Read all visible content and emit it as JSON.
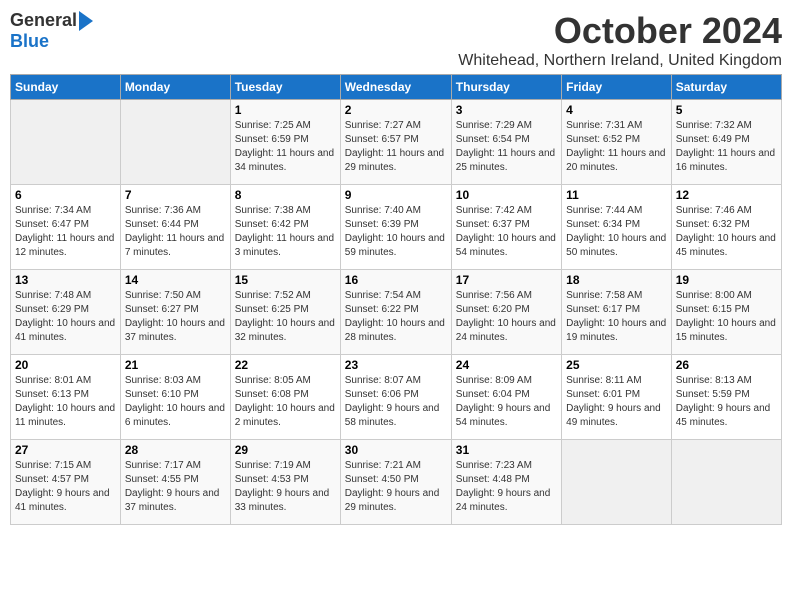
{
  "logo": {
    "general": "General",
    "blue": "Blue"
  },
  "title": "October 2024",
  "subtitle": "Whitehead, Northern Ireland, United Kingdom",
  "days_of_week": [
    "Sunday",
    "Monday",
    "Tuesday",
    "Wednesday",
    "Thursday",
    "Friday",
    "Saturday"
  ],
  "weeks": [
    [
      {
        "day": "",
        "info": ""
      },
      {
        "day": "",
        "info": ""
      },
      {
        "day": "1",
        "info": "Sunrise: 7:25 AM\nSunset: 6:59 PM\nDaylight: 11 hours and 34 minutes."
      },
      {
        "day": "2",
        "info": "Sunrise: 7:27 AM\nSunset: 6:57 PM\nDaylight: 11 hours and 29 minutes."
      },
      {
        "day": "3",
        "info": "Sunrise: 7:29 AM\nSunset: 6:54 PM\nDaylight: 11 hours and 25 minutes."
      },
      {
        "day": "4",
        "info": "Sunrise: 7:31 AM\nSunset: 6:52 PM\nDaylight: 11 hours and 20 minutes."
      },
      {
        "day": "5",
        "info": "Sunrise: 7:32 AM\nSunset: 6:49 PM\nDaylight: 11 hours and 16 minutes."
      }
    ],
    [
      {
        "day": "6",
        "info": "Sunrise: 7:34 AM\nSunset: 6:47 PM\nDaylight: 11 hours and 12 minutes."
      },
      {
        "day": "7",
        "info": "Sunrise: 7:36 AM\nSunset: 6:44 PM\nDaylight: 11 hours and 7 minutes."
      },
      {
        "day": "8",
        "info": "Sunrise: 7:38 AM\nSunset: 6:42 PM\nDaylight: 11 hours and 3 minutes."
      },
      {
        "day": "9",
        "info": "Sunrise: 7:40 AM\nSunset: 6:39 PM\nDaylight: 10 hours and 59 minutes."
      },
      {
        "day": "10",
        "info": "Sunrise: 7:42 AM\nSunset: 6:37 PM\nDaylight: 10 hours and 54 minutes."
      },
      {
        "day": "11",
        "info": "Sunrise: 7:44 AM\nSunset: 6:34 PM\nDaylight: 10 hours and 50 minutes."
      },
      {
        "day": "12",
        "info": "Sunrise: 7:46 AM\nSunset: 6:32 PM\nDaylight: 10 hours and 45 minutes."
      }
    ],
    [
      {
        "day": "13",
        "info": "Sunrise: 7:48 AM\nSunset: 6:29 PM\nDaylight: 10 hours and 41 minutes."
      },
      {
        "day": "14",
        "info": "Sunrise: 7:50 AM\nSunset: 6:27 PM\nDaylight: 10 hours and 37 minutes."
      },
      {
        "day": "15",
        "info": "Sunrise: 7:52 AM\nSunset: 6:25 PM\nDaylight: 10 hours and 32 minutes."
      },
      {
        "day": "16",
        "info": "Sunrise: 7:54 AM\nSunset: 6:22 PM\nDaylight: 10 hours and 28 minutes."
      },
      {
        "day": "17",
        "info": "Sunrise: 7:56 AM\nSunset: 6:20 PM\nDaylight: 10 hours and 24 minutes."
      },
      {
        "day": "18",
        "info": "Sunrise: 7:58 AM\nSunset: 6:17 PM\nDaylight: 10 hours and 19 minutes."
      },
      {
        "day": "19",
        "info": "Sunrise: 8:00 AM\nSunset: 6:15 PM\nDaylight: 10 hours and 15 minutes."
      }
    ],
    [
      {
        "day": "20",
        "info": "Sunrise: 8:01 AM\nSunset: 6:13 PM\nDaylight: 10 hours and 11 minutes."
      },
      {
        "day": "21",
        "info": "Sunrise: 8:03 AM\nSunset: 6:10 PM\nDaylight: 10 hours and 6 minutes."
      },
      {
        "day": "22",
        "info": "Sunrise: 8:05 AM\nSunset: 6:08 PM\nDaylight: 10 hours and 2 minutes."
      },
      {
        "day": "23",
        "info": "Sunrise: 8:07 AM\nSunset: 6:06 PM\nDaylight: 9 hours and 58 minutes."
      },
      {
        "day": "24",
        "info": "Sunrise: 8:09 AM\nSunset: 6:04 PM\nDaylight: 9 hours and 54 minutes."
      },
      {
        "day": "25",
        "info": "Sunrise: 8:11 AM\nSunset: 6:01 PM\nDaylight: 9 hours and 49 minutes."
      },
      {
        "day": "26",
        "info": "Sunrise: 8:13 AM\nSunset: 5:59 PM\nDaylight: 9 hours and 45 minutes."
      }
    ],
    [
      {
        "day": "27",
        "info": "Sunrise: 7:15 AM\nSunset: 4:57 PM\nDaylight: 9 hours and 41 minutes."
      },
      {
        "day": "28",
        "info": "Sunrise: 7:17 AM\nSunset: 4:55 PM\nDaylight: 9 hours and 37 minutes."
      },
      {
        "day": "29",
        "info": "Sunrise: 7:19 AM\nSunset: 4:53 PM\nDaylight: 9 hours and 33 minutes."
      },
      {
        "day": "30",
        "info": "Sunrise: 7:21 AM\nSunset: 4:50 PM\nDaylight: 9 hours and 29 minutes."
      },
      {
        "day": "31",
        "info": "Sunrise: 7:23 AM\nSunset: 4:48 PM\nDaylight: 9 hours and 24 minutes."
      },
      {
        "day": "",
        "info": ""
      },
      {
        "day": "",
        "info": ""
      }
    ]
  ]
}
